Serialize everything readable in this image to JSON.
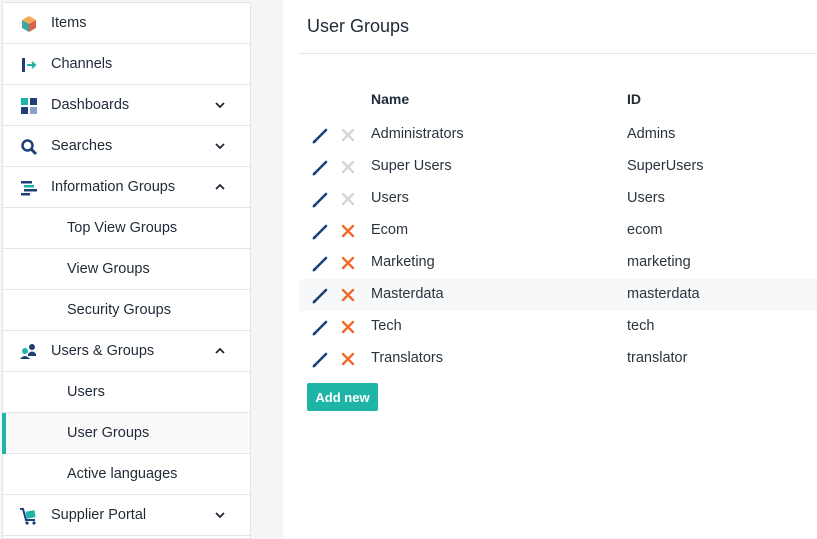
{
  "sidebar": {
    "items": [
      {
        "label": "Items",
        "icon": "cube-icon"
      },
      {
        "label": "Channels",
        "icon": "channel-arrow-icon"
      },
      {
        "label": "Dashboards",
        "icon": "dashboard-icon",
        "expanded": false
      },
      {
        "label": "Searches",
        "icon": "search-icon",
        "expanded": false
      },
      {
        "label": "Information Groups",
        "icon": "list-icon",
        "expanded": true
      },
      {
        "label": "Top View Groups"
      },
      {
        "label": "View Groups"
      },
      {
        "label": "Security Groups"
      },
      {
        "label": "Users & Groups",
        "icon": "users-icon",
        "expanded": true
      },
      {
        "label": "Users"
      },
      {
        "label": "User Groups",
        "active": true
      },
      {
        "label": "Active languages"
      },
      {
        "label": "Supplier Portal",
        "icon": "cart-icon",
        "expanded": false
      }
    ]
  },
  "main": {
    "title": "User Groups",
    "columns": {
      "name": "Name",
      "id": "ID"
    },
    "rows": [
      {
        "name": "Administrators",
        "id": "Admins",
        "deletable": false
      },
      {
        "name": "Super Users",
        "id": "SuperUsers",
        "deletable": false
      },
      {
        "name": "Users",
        "id": "Users",
        "deletable": false
      },
      {
        "name": "Ecom",
        "id": "ecom",
        "deletable": true
      },
      {
        "name": "Marketing",
        "id": "marketing",
        "deletable": true
      },
      {
        "name": "Masterdata",
        "id": "masterdata",
        "deletable": true
      },
      {
        "name": "Tech",
        "id": "tech",
        "deletable": true
      },
      {
        "name": "Translators",
        "id": "translator",
        "deletable": true
      }
    ],
    "add_label": "Add new"
  },
  "colors": {
    "accent": "#1fb5a6",
    "edit": "#1e3f78",
    "delete_enabled": "#ef6a2a",
    "delete_disabled": "#d3d6da"
  }
}
